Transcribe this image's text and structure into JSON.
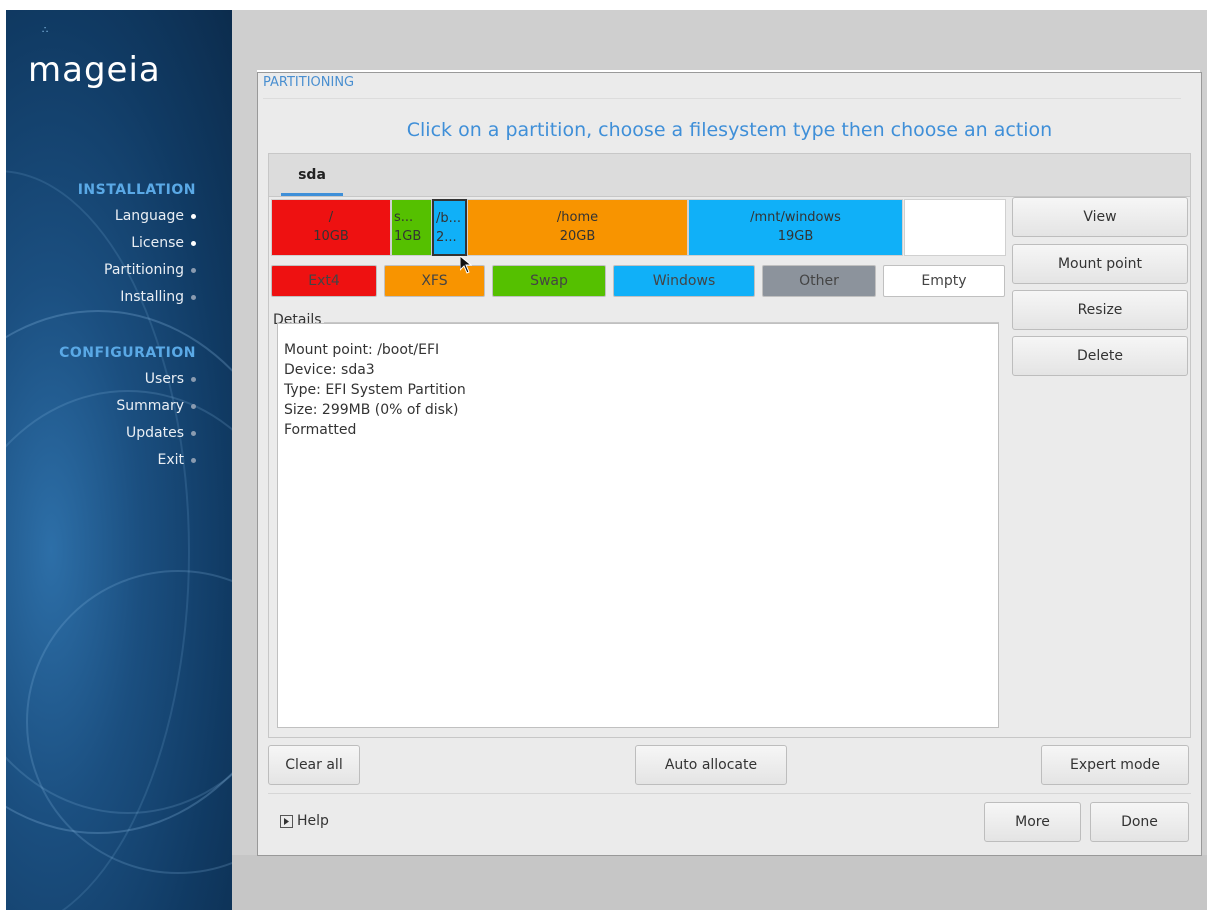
{
  "sidebar": {
    "logo": "mageia",
    "installation_heading": "INSTALLATION",
    "installation_steps": [
      {
        "label": "Language",
        "done": true
      },
      {
        "label": "License",
        "done": true
      },
      {
        "label": "Partitioning",
        "done": false
      },
      {
        "label": "Installing",
        "done": false
      }
    ],
    "configuration_heading": "CONFIGURATION",
    "configuration_steps": [
      {
        "label": "Users",
        "done": false
      },
      {
        "label": "Summary",
        "done": false
      },
      {
        "label": "Updates",
        "done": false
      },
      {
        "label": "Exit",
        "done": false
      }
    ]
  },
  "dialog": {
    "title": "PARTITIONING",
    "instruction": "Click on a partition, choose a filesystem type then choose an action",
    "tab": "sda",
    "partitions": [
      {
        "line1": "/",
        "line2": "10GB",
        "color": "#ee1111"
      },
      {
        "line1": "s...",
        "line2": "1GB",
        "color": "#55c000"
      },
      {
        "line1": "/b...",
        "line2": "2...",
        "color": "#10b0f8"
      },
      {
        "line1": "/home",
        "line2": "20GB",
        "color": "#f89400"
      },
      {
        "line1": "/mnt/windows",
        "line2": "19GB",
        "color": "#10b0f8"
      },
      {
        "line1": "",
        "line2": "",
        "color": "#ffffff"
      }
    ],
    "legend": [
      {
        "label": "Ext4",
        "color": "#ee1111"
      },
      {
        "label": "XFS",
        "color": "#f89400"
      },
      {
        "label": "Swap",
        "color": "#55c000"
      },
      {
        "label": "Windows",
        "color": "#10b0f8"
      },
      {
        "label": "Other",
        "color": "#8c939c"
      },
      {
        "label": "Empty",
        "color": "#ffffff"
      }
    ],
    "details_label": "Details",
    "details_lines": [
      "Mount point: /boot/EFI",
      "Device: sda3",
      "Type: EFI System Partition",
      "Size: 299MB (0% of disk)",
      "Formatted"
    ],
    "side_buttons": [
      "View",
      "Mount point",
      "Resize",
      "Delete"
    ],
    "clear_all": "Clear all",
    "auto_allocate": "Auto allocate",
    "expert_mode": "Expert mode",
    "help": "Help",
    "more": "More",
    "done": "Done"
  }
}
